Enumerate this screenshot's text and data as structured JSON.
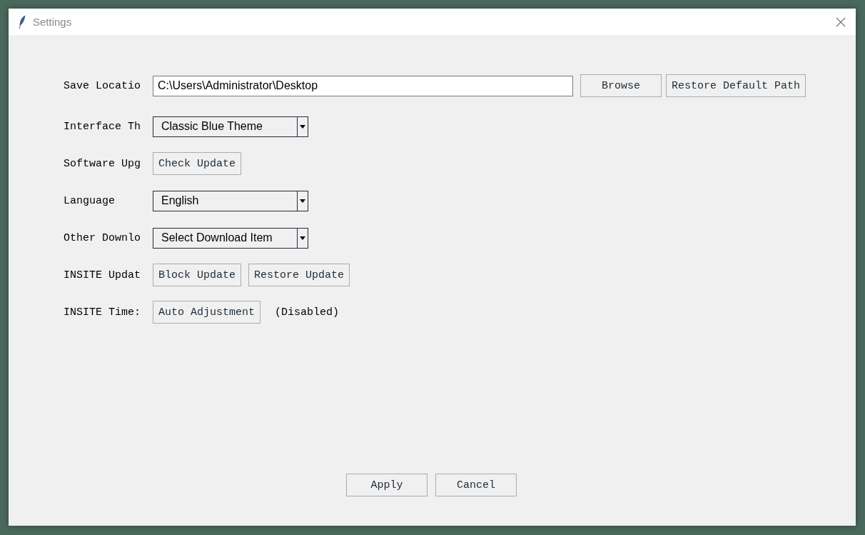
{
  "window": {
    "title": "Settings"
  },
  "rows": [
    {
      "label": "Save Locatio",
      "kind": "entry",
      "value": "C:\\Users\\Administrator\\Desktop",
      "buttons": [
        "Browse",
        "Restore Default Path"
      ]
    },
    {
      "label": "Interface Th",
      "kind": "combobox",
      "value": "Classic Blue Theme"
    },
    {
      "label": "Software Upg",
      "kind": "buttons",
      "buttons": [
        "Check Update"
      ]
    },
    {
      "label": "Language",
      "kind": "combobox",
      "value": "English"
    },
    {
      "label": "Other Downlo",
      "kind": "combobox",
      "value": "Select Download Item"
    },
    {
      "label": "INSITE Updat",
      "kind": "buttons",
      "buttons": [
        "Block Update",
        "Restore Update"
      ]
    },
    {
      "label": "INSITE Time:",
      "kind": "buttons",
      "buttons": [
        "Auto Adjustment"
      ],
      "note": "(Disabled)"
    }
  ],
  "footer_buttons": [
    "Apply",
    "Cancel"
  ]
}
